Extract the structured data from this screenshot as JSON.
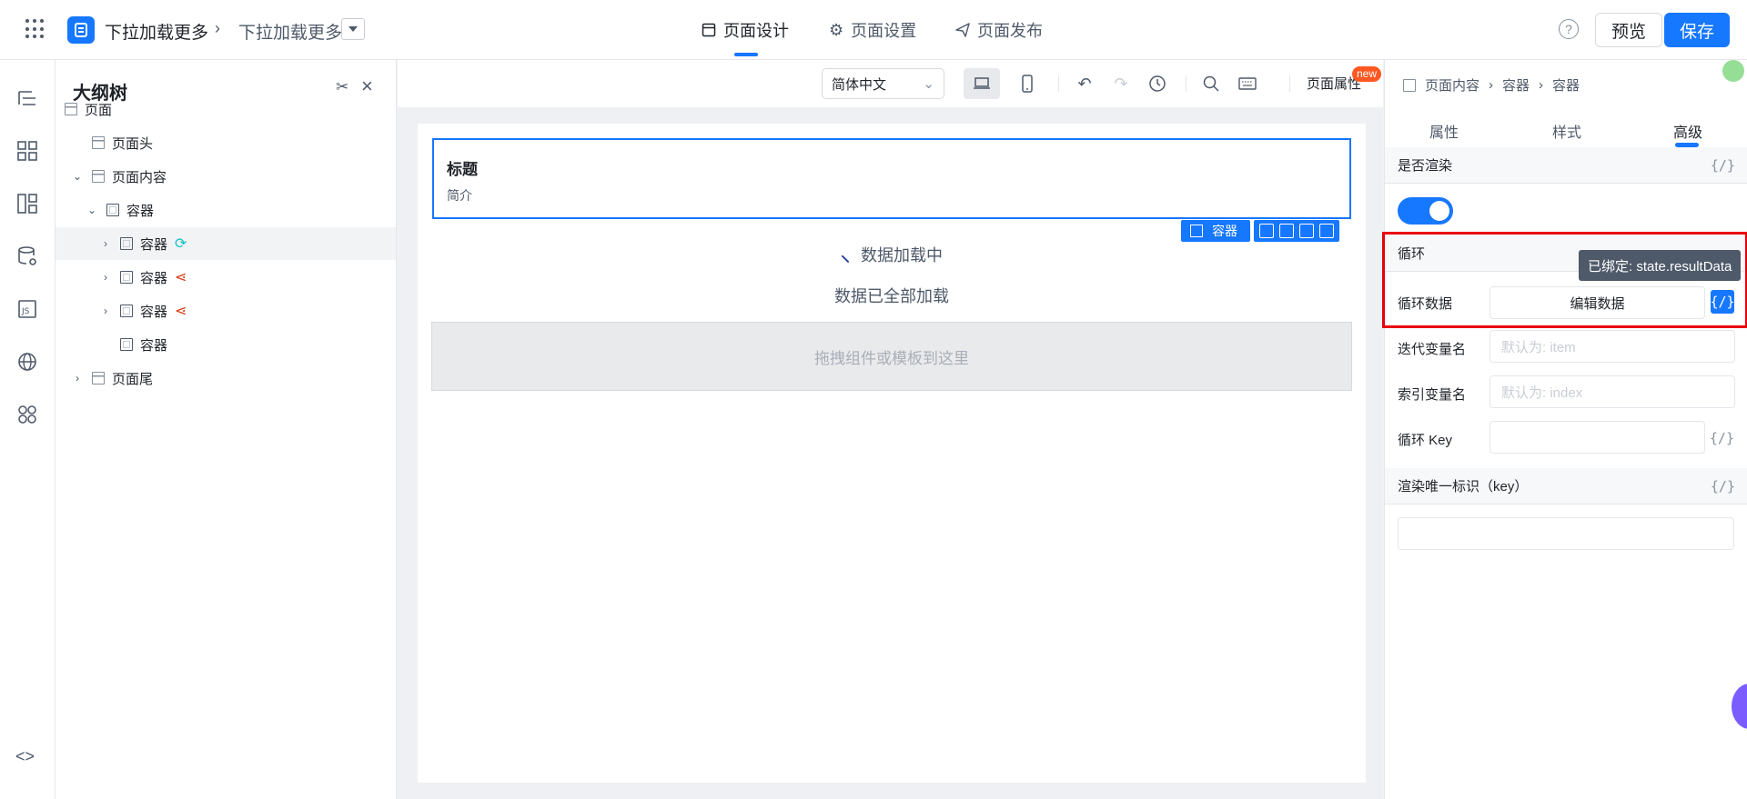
{
  "app": {
    "name": "下拉加载更多",
    "page_name": "下拉加载更多"
  },
  "top_tabs": [
    {
      "label": "页面设计",
      "icon": "layout-icon"
    },
    {
      "label": "页面设置",
      "icon": "gear-icon"
    },
    {
      "label": "页面发布",
      "icon": "send-icon"
    }
  ],
  "actions": {
    "help": "?",
    "preview": "预览",
    "save": "保存"
  },
  "outline": {
    "title": "大纲树",
    "nodes": [
      {
        "label": "页面"
      },
      {
        "label": "页面头"
      },
      {
        "label": "页面内容"
      },
      {
        "label": "容器"
      },
      {
        "label": "容器"
      },
      {
        "label": "容器"
      },
      {
        "label": "容器"
      },
      {
        "label": "容器"
      },
      {
        "label": "页面尾"
      }
    ]
  },
  "canvas_toolbar": {
    "language": "简体中文",
    "page_attr": "页面属性",
    "new_badge": "new"
  },
  "canvas": {
    "title": "标题",
    "subtitle": "简介",
    "selected_label": "容器",
    "loading_text": "数据加载中",
    "loaded_all_text": "数据已全部加载",
    "drop_hint": "拖拽组件或模板到这里"
  },
  "props": {
    "breadcrumb": [
      "页面内容",
      "容器",
      "容器"
    ],
    "tabs": [
      "属性",
      "样式",
      "高级"
    ],
    "render_label": "是否渲染",
    "render_enabled": true,
    "loop_label": "循环",
    "loop_data_label": "循环数据",
    "edit_data_button": "编辑数据",
    "tooltip": "已绑定: state.resultData",
    "iter_var_label": "迭代变量名",
    "iter_var_placeholder": "默认为: item",
    "index_var_label": "索引变量名",
    "index_var_placeholder": "默认为: index",
    "loop_key_label": "循环 Key",
    "unique_key_label": "渲染唯一标识（key）",
    "bind_symbol": "{/}"
  },
  "colors": {
    "primary": "#1677ff",
    "highlight": "#e8000b"
  }
}
